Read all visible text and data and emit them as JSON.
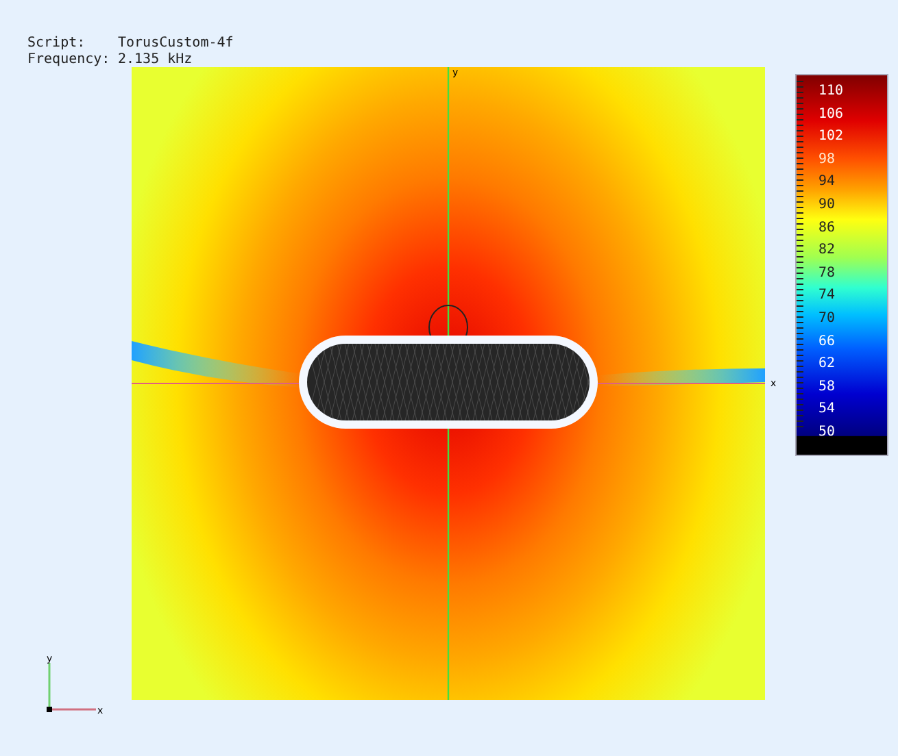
{
  "info": [
    {
      "label": "Script:",
      "value": "TorusCustom-4f"
    },
    {
      "label": "Frequency:",
      "value": "2.135 kHz"
    }
  ],
  "viewport": {
    "axis_labels": {
      "x": "x",
      "y": "y"
    }
  },
  "triad": {
    "x": "x",
    "y": "y"
  },
  "colorbar": {
    "labels": [
      "110",
      "106",
      "102",
      "98",
      "94",
      "90",
      "86",
      "82",
      "78",
      "74",
      "70",
      "66",
      "62",
      "58",
      "54",
      "50"
    ]
  }
}
